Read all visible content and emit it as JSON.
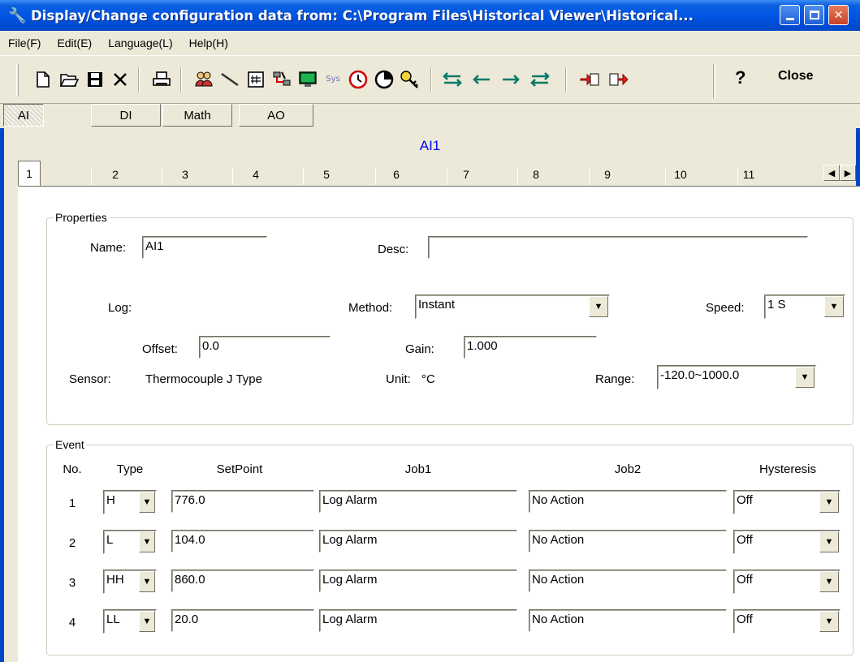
{
  "window": {
    "title": "Display/Change configuration data from: C:\\Program Files\\Historical Viewer\\Historical..."
  },
  "menu": [
    "File(F)",
    "Edit(E)",
    "Language(L)",
    "Help(H)"
  ],
  "toolbar": {
    "help_label": "?",
    "close_label": "Close",
    "sys_label": "Sys"
  },
  "category_tabs": [
    "AI",
    "DI",
    "Math",
    "AO"
  ],
  "panel_title": "AI1",
  "number_tabs": [
    "1",
    "2",
    "3",
    "4",
    "5",
    "6",
    "7",
    "8",
    "9",
    "10",
    "11"
  ],
  "properties": {
    "legend": "Properties",
    "name_label": "Name:",
    "name_value": "AI1",
    "desc_label": "Desc:",
    "desc_value": "",
    "log_label": "Log:",
    "method_label": "Method:",
    "method_value": "Instant",
    "speed_label": "Speed:",
    "speed_value": "1 S",
    "offset_label": "Offset:",
    "offset_value": "0.0",
    "gain_label": "Gain:",
    "gain_value": "1.000",
    "sensor_label": "Sensor:",
    "sensor_value": "Thermocouple J Type",
    "unit_label": "Unit:",
    "unit_value": "°C",
    "range_label": "Range:",
    "range_value": "-120.0~1000.0"
  },
  "event": {
    "legend": "Event",
    "headers": [
      "No.",
      "Type",
      "SetPoint",
      "Job1",
      "Job2",
      "Hysteresis"
    ],
    "rows": [
      {
        "no": "1",
        "type": "H",
        "setpoint": "776.0",
        "job1": "Log Alarm",
        "job2": "No Action",
        "hysteresis": "Off"
      },
      {
        "no": "2",
        "type": "L",
        "setpoint": "104.0",
        "job1": "Log Alarm",
        "job2": "No Action",
        "hysteresis": "Off"
      },
      {
        "no": "3",
        "type": "HH",
        "setpoint": "860.0",
        "job1": "Log Alarm",
        "job2": "No Action",
        "hysteresis": "Off"
      },
      {
        "no": "4",
        "type": "LL",
        "setpoint": "20.0",
        "job1": "Log Alarm",
        "job2": "No Action",
        "hysteresis": "Off"
      }
    ]
  }
}
